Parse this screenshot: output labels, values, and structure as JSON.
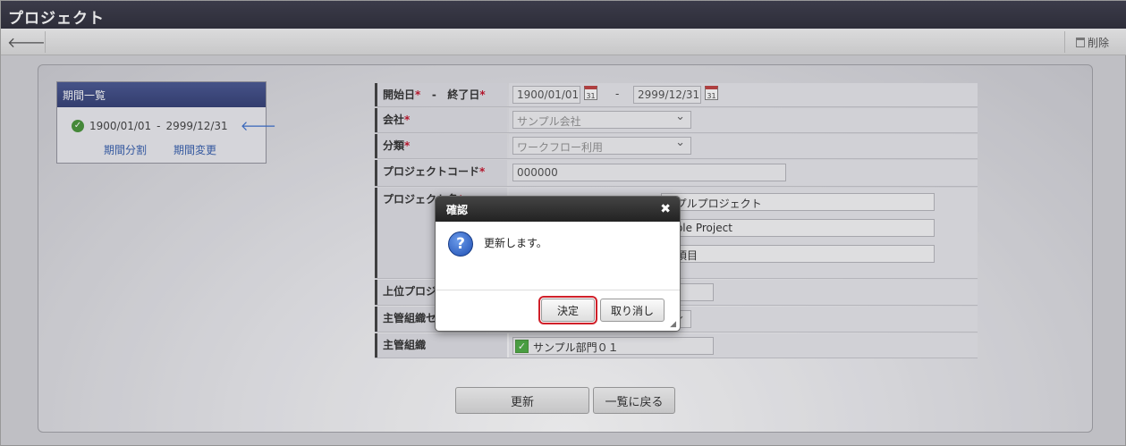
{
  "window": {
    "title": "プロジェクト"
  },
  "toolbar": {
    "delete_label": "削除"
  },
  "period_panel": {
    "title": "期間一覧",
    "start": "1900/01/01",
    "separator": "-",
    "end": "2999/12/31",
    "split_link": "期間分割",
    "change_link": "期間変更"
  },
  "form": {
    "date_label_start": "開始日",
    "date_label_end": "終了日",
    "date_separator": "-",
    "start_date": "1900/01/01",
    "end_date": "2999/12/31",
    "calendar_day": "31",
    "required_mark": "*",
    "company_label": "会社",
    "company_value": "サンプル会社",
    "category_label": "分類",
    "category_value": "ワークフロー利用",
    "code_label": "プロジェクトコード",
    "code_value": "000000",
    "name_label": "プロジェクト名",
    "name_ja": "ンプルプロジェクト",
    "name_en": "mple Project",
    "name_other": "例項目",
    "parent_label": "上位プロジ",
    "org_set_label": "主管組織セ",
    "org_label": "主管組織",
    "org_value": "サンプル部門０１"
  },
  "buttons": {
    "update": "更新",
    "back_to_list": "一覧に戻る"
  },
  "dialog": {
    "title": "確認",
    "message": "更新します。",
    "ok": "決定",
    "cancel": "取り消し"
  }
}
